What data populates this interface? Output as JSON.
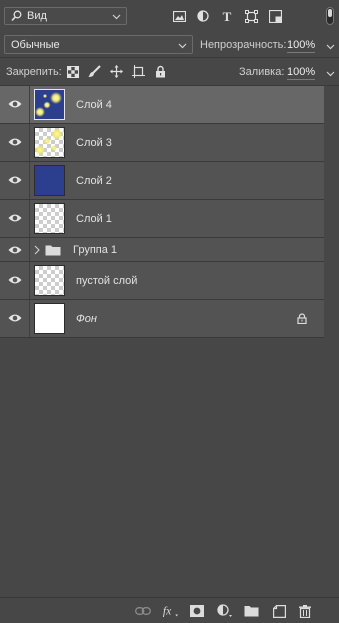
{
  "filter": {
    "kind_label": "Вид",
    "icons": [
      "image-filter-icon",
      "adjustment-filter-icon",
      "type-filter-icon",
      "shape-filter-icon",
      "smart-object-filter-icon",
      "filter-toggle-icon"
    ]
  },
  "blend": {
    "mode": "Обычные",
    "opacity_label": "Непрозрачность:",
    "opacity_value": "100%"
  },
  "lock": {
    "label": "Закрепить:",
    "icons": [
      "lock-transparent-pixels-icon",
      "lock-image-pixels-icon",
      "lock-position-icon",
      "lock-artboard-icon",
      "lock-all-icon"
    ],
    "fill_label": "Заливка:",
    "fill_value": "100%"
  },
  "layers": [
    {
      "name": "Слой 4",
      "type": "pixel",
      "thumbnail": "blue-with-glows",
      "selected": true,
      "visible": true
    },
    {
      "name": "Слой 3",
      "type": "pixel",
      "thumbnail": "transparent-with-glows",
      "selected": false,
      "visible": true
    },
    {
      "name": "Слой 2",
      "type": "pixel",
      "thumbnail": "solid-blue",
      "selected": false,
      "visible": true
    },
    {
      "name": "Слой 1",
      "type": "pixel",
      "thumbnail": "transparent",
      "selected": false,
      "visible": true
    },
    {
      "name": "Группа 1",
      "type": "group",
      "collapsed": true,
      "visible": true
    },
    {
      "name": "пустой слой",
      "type": "pixel",
      "thumbnail": "transparent",
      "selected": false,
      "visible": true
    },
    {
      "name": "Фон",
      "type": "background",
      "thumbnail": "white",
      "locked": true,
      "visible": true
    }
  ],
  "bottom_icons": [
    "link-layers-icon",
    "fx-icon",
    "add-mask-icon",
    "new-adjustment-icon",
    "new-group-icon",
    "new-layer-icon",
    "delete-layer-icon"
  ],
  "colors": {
    "panel_bg": "#474747",
    "row_bg": "#535353",
    "selected_bg": "#676767",
    "blue_fill": "#2c3f8f",
    "glow": "#f5f08a"
  }
}
